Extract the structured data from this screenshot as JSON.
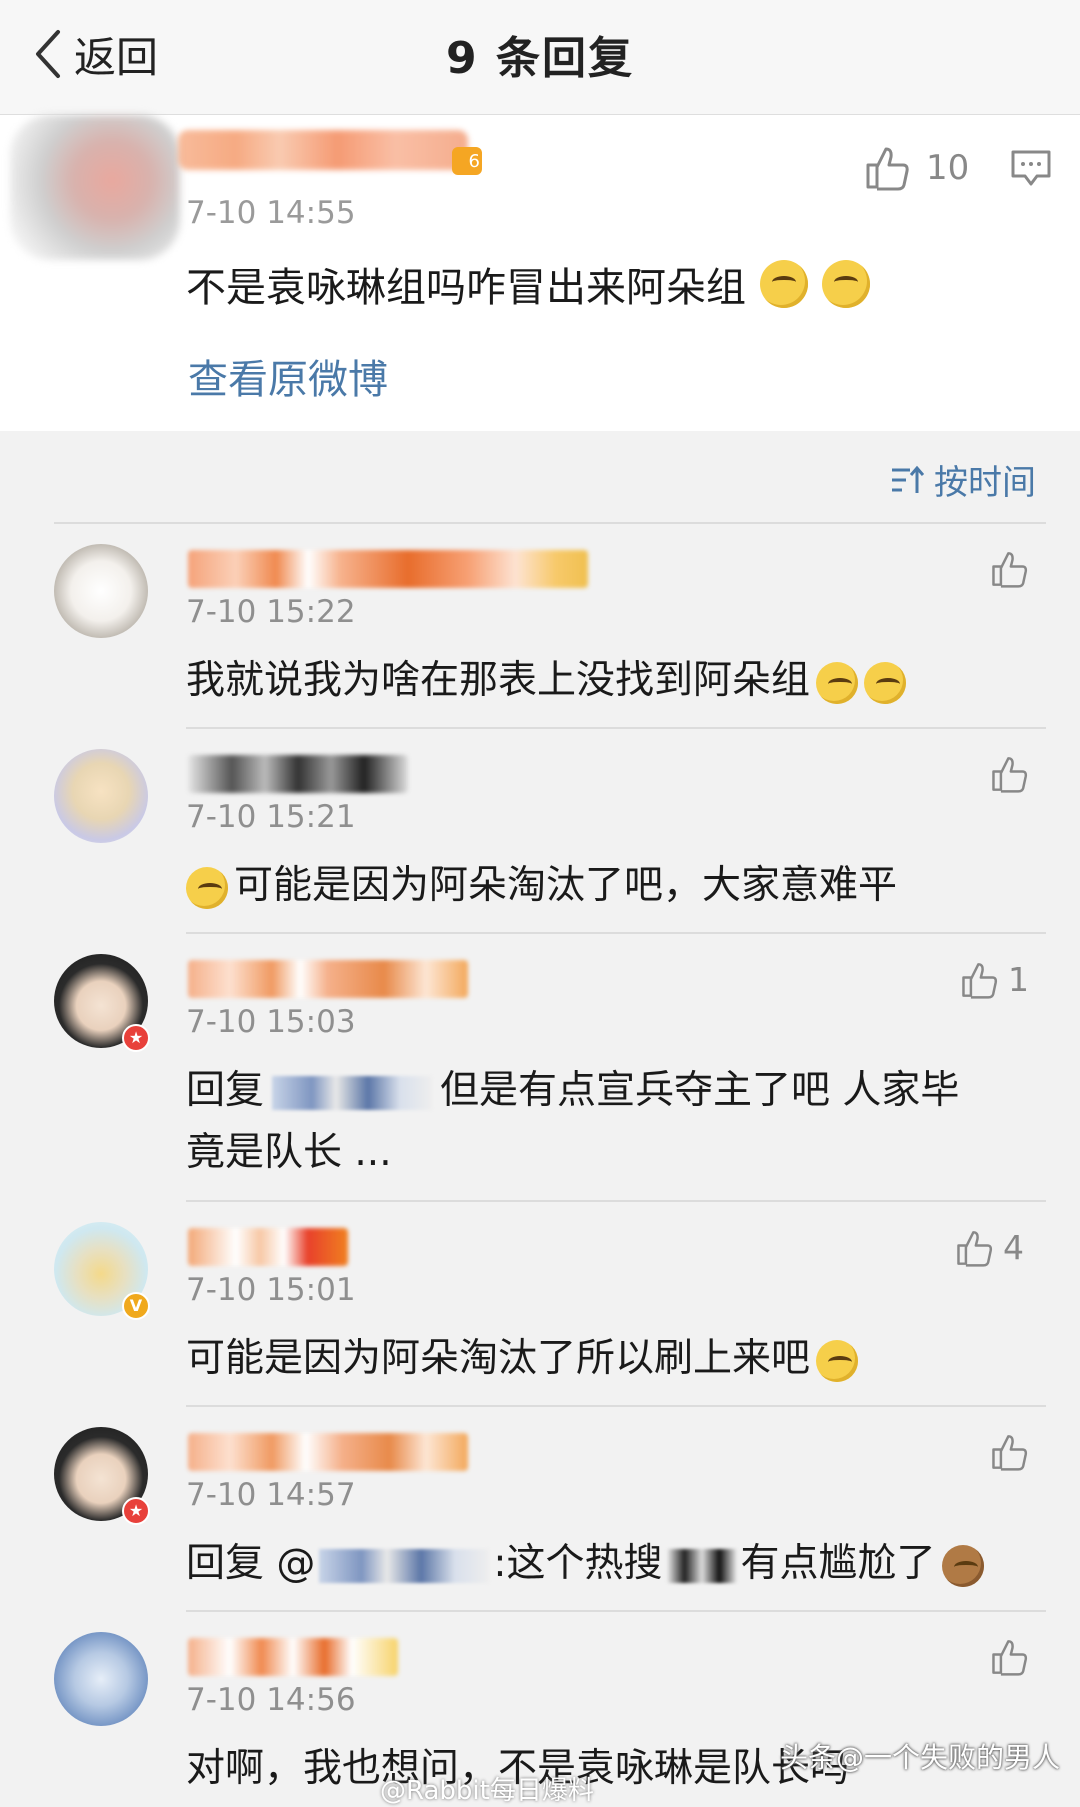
{
  "nav": {
    "back_label": "返回",
    "title": "9 条回复"
  },
  "post": {
    "time": "7-10 14:55",
    "level": "6",
    "text": "不是袁咏琳组吗咋冒出来阿朵组",
    "likes": "10",
    "view_original": "查看原微博"
  },
  "sort": {
    "label": "按时间"
  },
  "comments": [
    {
      "time": "7-10 15:22",
      "text": "我就说我为啥在那表上没找到阿朵组",
      "likes": ""
    },
    {
      "time": "7-10 15:21",
      "text": "可能是因为阿朵淘汰了吧，大家意难平",
      "likes": ""
    },
    {
      "time": "7-10 15:03",
      "reply_prefix": "回复",
      "text": "但是有点宣兵夺主了吧 人家毕",
      "text2": "竟是队长 ...",
      "likes": "1"
    },
    {
      "time": "7-10 15:01",
      "text": "可能是因为阿朵淘汰了所以刷上来吧",
      "likes": "4"
    },
    {
      "time": "7-10 14:57",
      "reply_prefix": "回复 @",
      "text": ":这个热搜",
      "text2": "有点尴尬了",
      "likes": ""
    },
    {
      "time": "7-10 14:56",
      "text": "对啊，我也想问，不是袁咏琳是队长吗",
      "likes": ""
    }
  ],
  "watermark": {
    "text": "头条@一个失败的男人",
    "text2": "@Rabbit每日爆料"
  },
  "colors": {
    "link": "#4a79a8",
    "time": "#8f8f8f",
    "badge_red": "#e8413b",
    "badge_gold": "#f0a91d"
  }
}
